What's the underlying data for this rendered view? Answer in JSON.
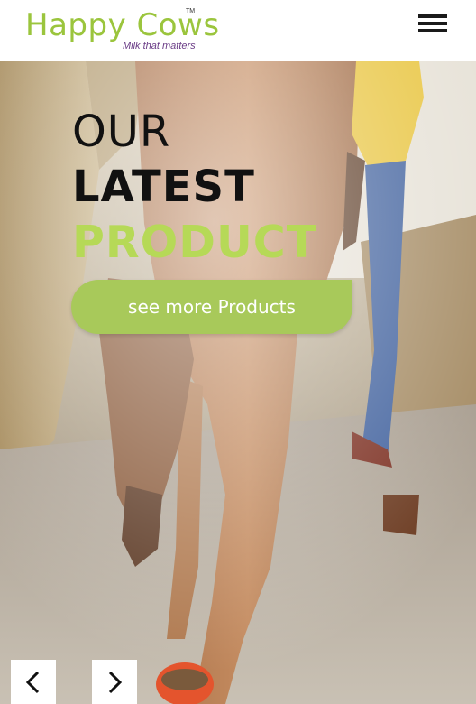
{
  "header": {
    "logo": {
      "name": "Happy Cows",
      "trademark": "TM",
      "tagline": "Milk that matters"
    },
    "menu_icon": "hamburger-menu-icon"
  },
  "hero": {
    "line1": "OUR",
    "line2": "LATEST",
    "line3": "PRODUCT",
    "cta_label": "see more Products"
  },
  "carousel": {
    "prev_icon": "chevron-left-icon",
    "next_icon": "chevron-right-icon"
  },
  "colors": {
    "brand_green": "#9bc53d",
    "product_green": "#b6d957",
    "button_green": "#a8c95a",
    "tagline_purple": "#6a3c86",
    "text_dark": "#111111"
  }
}
